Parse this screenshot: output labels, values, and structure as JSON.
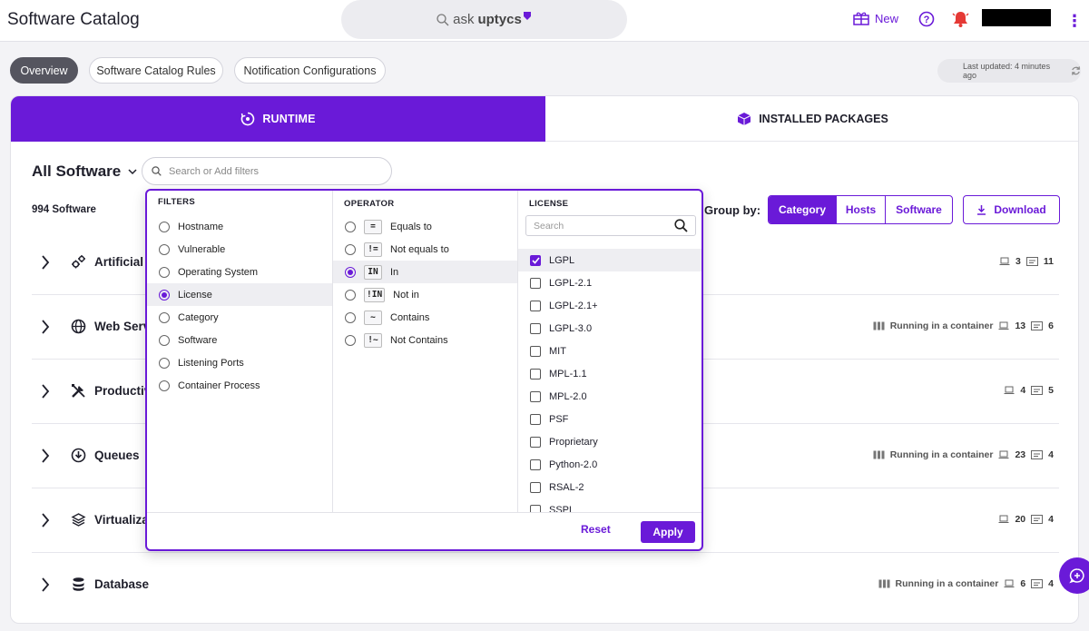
{
  "app": {
    "title": "Software Catalog"
  },
  "ask": {
    "prefix": "ask",
    "brand": "uptycs"
  },
  "header": {
    "new_label": "New"
  },
  "subtabs": [
    {
      "label": "Overview",
      "active": true
    },
    {
      "label": "Software Catalog Rules",
      "active": false
    },
    {
      "label": "Notification Configurations",
      "active": false
    }
  ],
  "last_updated": "Last updated: 4 minutes ago",
  "main_tabs": {
    "runtime": "RUNTIME",
    "installed": "INSTALLED PACKAGES"
  },
  "view": {
    "all_software": "All Software",
    "search_placeholder": "Search or Add filters",
    "count": "994 Software",
    "groupby_label": "Group by:",
    "groupby_options": [
      "Category",
      "Hosts",
      "Software"
    ],
    "groupby_selected": "Category",
    "download": "Download"
  },
  "rows": [
    {
      "name": "Artificial",
      "icon": "gears-icon",
      "container": "",
      "hosts": "3",
      "software": "11"
    },
    {
      "name": "Web Serv",
      "icon": "globe-icon",
      "container": "Running in a container",
      "hosts": "13",
      "software": "6"
    },
    {
      "name": "Productiv",
      "icon": "tools-icon",
      "container": "",
      "hosts": "4",
      "software": "5"
    },
    {
      "name": "Queues",
      "icon": "queue-icon",
      "container": "Running in a container",
      "hosts": "23",
      "software": "4"
    },
    {
      "name": "Virtualiza",
      "icon": "layers-icon",
      "container": "",
      "hosts": "20",
      "software": "4"
    },
    {
      "name": "Database",
      "icon": "database-icon",
      "container": "Running in a container",
      "hosts": "6",
      "software": "4"
    }
  ],
  "filter_popup": {
    "filters_header": "FILTERS",
    "filters": [
      "Hostname",
      "Vulnerable",
      "Operating System",
      "License",
      "Category",
      "Software",
      "Listening Ports",
      "Container Process"
    ],
    "filters_selected": "License",
    "operator_header": "OPERATOR",
    "operators": [
      {
        "symbol": "=",
        "label": "Equals to"
      },
      {
        "symbol": "!=",
        "label": "Not equals to"
      },
      {
        "symbol": "IN",
        "label": "In"
      },
      {
        "symbol": "!IN",
        "label": "Not in"
      },
      {
        "symbol": "~",
        "label": "Contains"
      },
      {
        "symbol": "!~",
        "label": "Not Contains"
      }
    ],
    "operator_selected": "In",
    "license_header": "LICENSE",
    "license_search_placeholder": "Search",
    "licenses": [
      "LGPL",
      "LGPL-2.1",
      "LGPL-2.1+",
      "LGPL-3.0",
      "MIT",
      "MPL-1.1",
      "MPL-2.0",
      "PSF",
      "Proprietary",
      "Python-2.0",
      "RSAL-2",
      "SSPL"
    ],
    "licenses_checked": [
      "LGPL"
    ],
    "reset": "Reset",
    "apply": "Apply"
  },
  "colors": {
    "accent": "#6a1ad8",
    "bell": "#e53935"
  }
}
